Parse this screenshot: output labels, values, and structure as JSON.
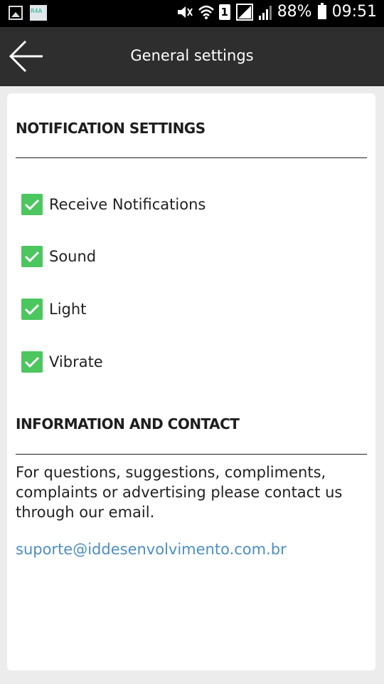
{
  "status_bar": {
    "battery": "88%",
    "time": "09:51",
    "sim_label": "1",
    "app_icon_text": "R4A"
  },
  "app_bar": {
    "title": "General settings",
    "back_icon": "arrow-left-icon"
  },
  "notification_section": {
    "title": "NOTIFICATION SETTINGS",
    "items": [
      {
        "label": "Receive Notifications",
        "checked": true
      },
      {
        "label": "Sound",
        "checked": true
      },
      {
        "label": "Light",
        "checked": true
      },
      {
        "label": "Vibrate",
        "checked": true
      }
    ]
  },
  "info_section": {
    "title": "INFORMATION AND CONTACT",
    "text": "For questions, suggestions, compliments, complaints or advertising please contact us through our email.",
    "email": "suporte@iddesenvolvimento.com.br"
  },
  "colors": {
    "app_bar": "#2e2e2e",
    "checkbox": "#4cc65e",
    "link": "#4c8ec2",
    "background": "#ececec"
  }
}
